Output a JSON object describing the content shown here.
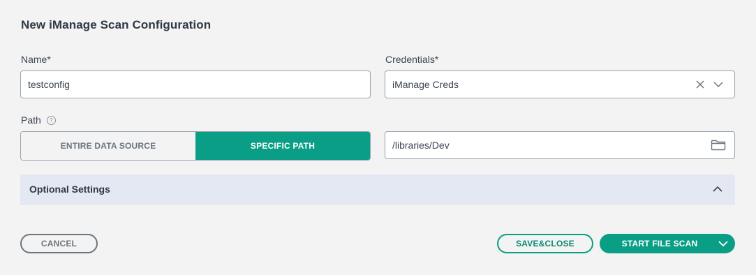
{
  "dialog": {
    "title": "New iManage Scan Configuration"
  },
  "name_field": {
    "label": "Name*",
    "value": "testconfig"
  },
  "credentials_field": {
    "label": "Credentials*",
    "value": "iManage Creds",
    "clear_icon": "close-icon",
    "dropdown_icon": "chevron-down-icon"
  },
  "path": {
    "label": "Path",
    "help_icon": "help-circle-icon",
    "options": [
      "ENTIRE DATA SOURCE",
      "SPECIFIC PATH"
    ],
    "selected": "SPECIFIC PATH",
    "path_value": "/libraries/Dev",
    "browse_icon": "folder-icon"
  },
  "optional_settings": {
    "label": "Optional Settings",
    "expanded": true
  },
  "footer": {
    "cancel_label": "CANCEL",
    "save_close_label": "SAVE&CLOSE",
    "start_scan_label": "START FILE SCAN"
  },
  "colors": {
    "accent": "#0a9e86",
    "background": "#f2f3f2",
    "accordion_bg": "#e3e8f2"
  }
}
